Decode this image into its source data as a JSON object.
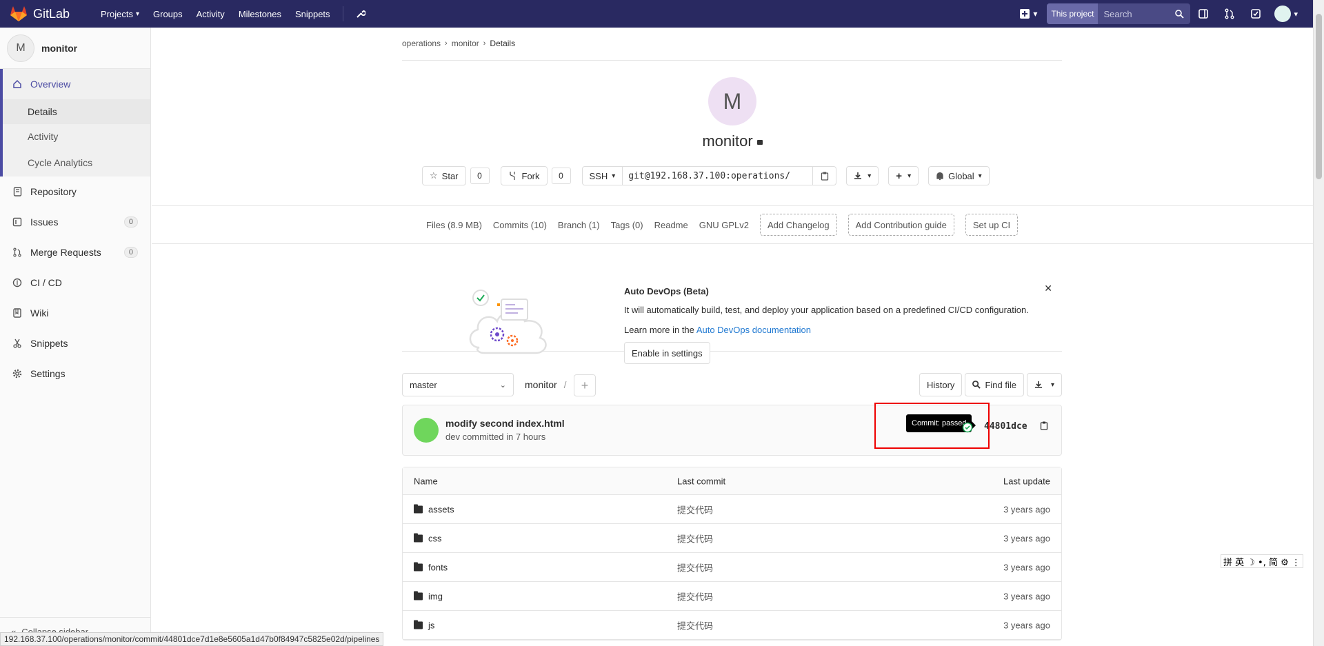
{
  "nav": {
    "brand": "GitLab",
    "links": [
      "Projects",
      "Groups",
      "Activity",
      "Milestones",
      "Snippets"
    ],
    "scope_chip": "This project",
    "search_placeholder": "Search"
  },
  "sidebar": {
    "project_initial": "M",
    "project_name": "monitor",
    "overview_label": "Overview",
    "sub_items": [
      "Details",
      "Activity",
      "Cycle Analytics"
    ],
    "items": [
      {
        "label": "Repository"
      },
      {
        "label": "Issues",
        "count": "0"
      },
      {
        "label": "Merge Requests",
        "count": "0"
      },
      {
        "label": "CI / CD"
      },
      {
        "label": "Wiki"
      },
      {
        "label": "Snippets"
      },
      {
        "label": "Settings"
      }
    ],
    "collapse_label": "Collapse sidebar"
  },
  "breadcrumb": [
    "operations",
    "monitor",
    "Details"
  ],
  "project": {
    "initial": "M",
    "title": "monitor",
    "star_label": "Star",
    "star_count": "0",
    "fork_label": "Fork",
    "fork_count": "0",
    "clone_protocol": "SSH",
    "clone_url": "git@192.168.37.100:operations/",
    "notification_label": "Global"
  },
  "stats": {
    "files": "Files (8.9 MB)",
    "commits": "Commits (10)",
    "branch": "Branch (1)",
    "tags": "Tags (0)",
    "readme": "Readme",
    "license": "GNU GPLv2",
    "add_changelog": "Add Changelog",
    "add_contrib": "Add Contribution guide",
    "setup_ci": "Set up CI"
  },
  "devops": {
    "title": "Auto DevOps (Beta)",
    "description": "It will automatically build, test, and deploy your application based on a predefined CI/CD configuration.",
    "learn_prefix": "Learn more in the",
    "learn_link": "Auto DevOps documentation",
    "enable_button": "Enable in settings"
  },
  "repo_toolbar": {
    "branch": "master",
    "path": "monitor",
    "path_sep": "/",
    "history": "History",
    "find_file": "Find file"
  },
  "last_commit": {
    "message": "modify second index.html",
    "meta": "dev committed in 7 hours",
    "tooltip": "Commit: passed",
    "sha": "44801dce"
  },
  "file_table": {
    "headers": {
      "name": "Name",
      "last_commit": "Last commit",
      "last_update": "Last update"
    },
    "rows": [
      {
        "name": "assets",
        "commit": "提交代码",
        "updated": "3 years ago"
      },
      {
        "name": "css",
        "commit": "提交代码",
        "updated": "3 years ago"
      },
      {
        "name": "fonts",
        "commit": "提交代码",
        "updated": "3 years ago"
      },
      {
        "name": "img",
        "commit": "提交代码",
        "updated": "3 years ago"
      },
      {
        "name": "js",
        "commit": "提交代码",
        "updated": "3 years ago"
      }
    ]
  },
  "status_url": "192.168.37.100/operations/monitor/commit/44801dce7d1e8e5605a1d47b0f84947c5825e02d/pipelines",
  "ime_bar": "拼 英 ☽ •, 简 ⚙ ⋮",
  "colors": {
    "nav_bg": "#292961",
    "accent": "#4b4ba3",
    "link": "#1f78d1",
    "success": "#1aaa55",
    "highlight": "#e00000"
  }
}
